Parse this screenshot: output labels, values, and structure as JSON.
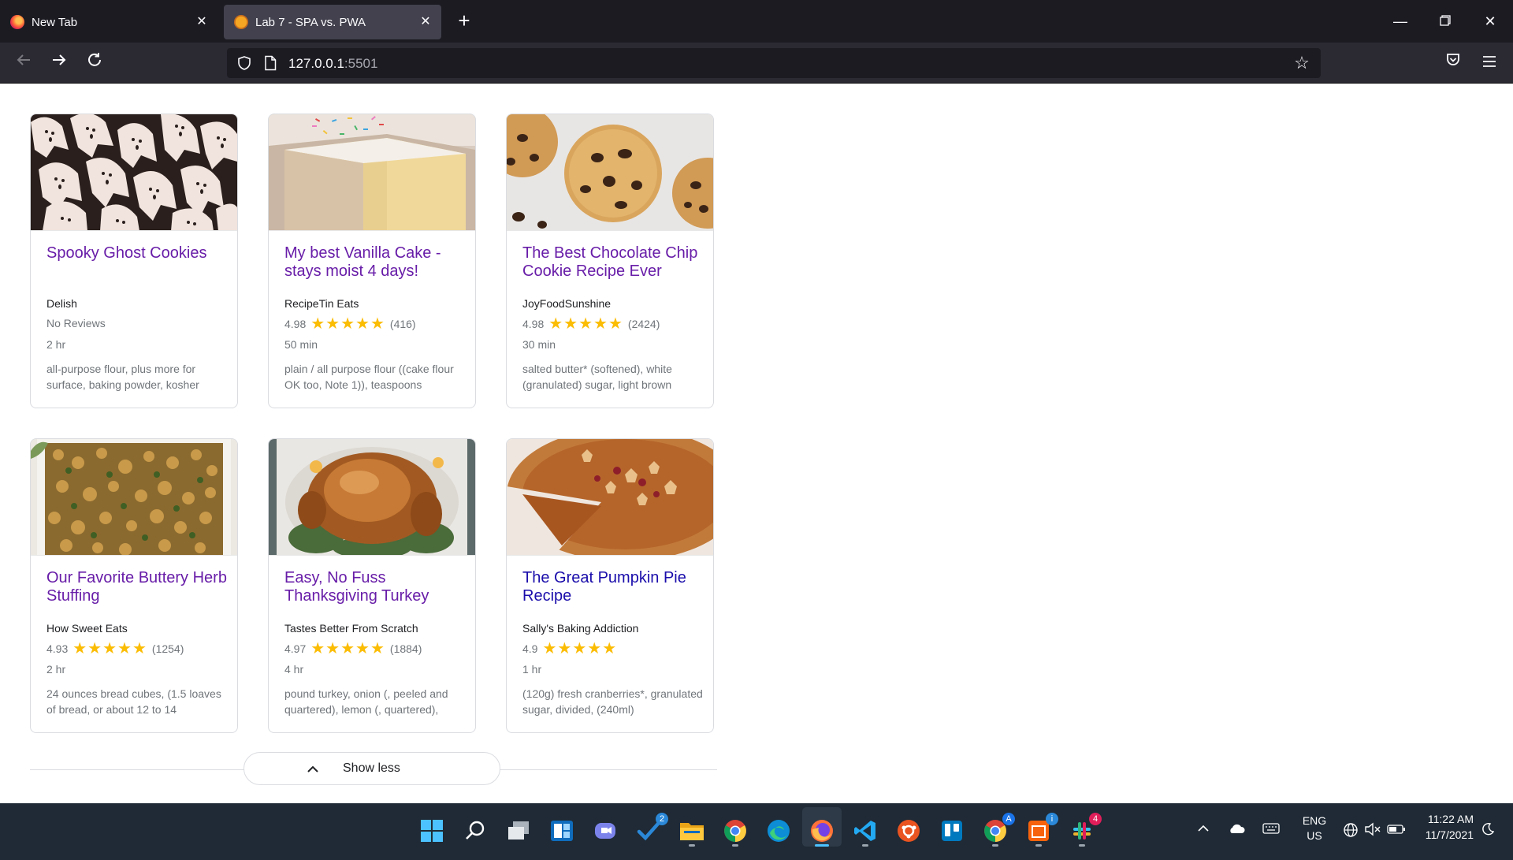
{
  "browser": {
    "tabs": [
      {
        "title": "New Tab",
        "active": false
      },
      {
        "title": "Lab 7 - SPA vs. PWA",
        "active": true
      }
    ],
    "url_host": "127.0.0.1",
    "url_port": ":5501"
  },
  "recipes": [
    {
      "title": "Spooky Ghost Cookies",
      "source": "Delish",
      "rating_text": "No Reviews",
      "rating": null,
      "count": "",
      "time": "2 hr",
      "ingredients": "all-purpose flour, plus more for surface, baking powder, kosher",
      "image": "ghost-cookies",
      "visited": true
    },
    {
      "title": "My best Vanilla Cake - stays moist 4 days!",
      "source": "RecipeTin Eats",
      "rating_text": "4.98",
      "rating": 4.98,
      "count": "(416)",
      "time": "50 min",
      "ingredients": "plain / all purpose flour ((cake flour OK too, Note 1)), teaspoons",
      "image": "vanilla-cake",
      "visited": true
    },
    {
      "title": "The Best Chocolate Chip Cookie Recipe Ever",
      "source": "JoyFoodSunshine",
      "rating_text": "4.98",
      "rating": 4.98,
      "count": "(2424)",
      "time": "30 min",
      "ingredients": "salted butter* (softened), white (granulated) sugar, light brown",
      "image": "chocolate-chip-cookies",
      "visited": true
    },
    {
      "title": "Our Favorite Buttery Herb Stuffing",
      "source": "How Sweet Eats",
      "rating_text": "4.93",
      "rating": 4.93,
      "count": "(1254)",
      "time": "2 hr",
      "ingredients": "24 ounces bread cubes, (1.5 loaves of bread, or about 12 to 14",
      "image": "herb-stuffing",
      "visited": true
    },
    {
      "title": "Easy, No Fuss Thanksgiving Turkey",
      "source": "Tastes Better From Scratch",
      "rating_text": "4.97",
      "rating": 4.97,
      "count": "(1884)",
      "time": "4 hr",
      "ingredients": "pound turkey, onion (, peeled and quartered), lemon (, quartered),",
      "image": "roast-turkey",
      "visited": true
    },
    {
      "title": "The Great Pumpkin Pie Recipe",
      "source": "Sally's Baking Addiction",
      "rating_text": "4.9",
      "rating": 4.9,
      "count": "",
      "time": "1 hr",
      "ingredients": "(120g) fresh cranberries*, granulated sugar, divided, (240ml)",
      "image": "pumpkin-pie",
      "visited": false
    }
  ],
  "stars": "★★★★★",
  "show_less_label": "Show less",
  "taskbar": {
    "apps": [
      "start-icon",
      "search-icon",
      "task-view-icon",
      "widgets-icon",
      "teams-chat-icon",
      "todo-icon",
      "file-explorer-icon",
      "chrome-icon",
      "edge-icon",
      "firefox-icon",
      "vscode-icon",
      "ubuntu-icon",
      "trello-icon",
      "chrome-profile-icon",
      "app-icon",
      "slack-icon"
    ],
    "todo_badge": "2",
    "app_badge": "i",
    "slack_badge": "4",
    "language_top": "ENG",
    "language_bottom": "US",
    "clock_time": "11:22 AM",
    "clock_date": "11/7/2021"
  },
  "colors": {
    "visited_link": "#681da8",
    "link": "#1a0dab",
    "star": "#fbbc04",
    "taskbar": "#1f2a36",
    "chrome": "#2b2a33"
  }
}
